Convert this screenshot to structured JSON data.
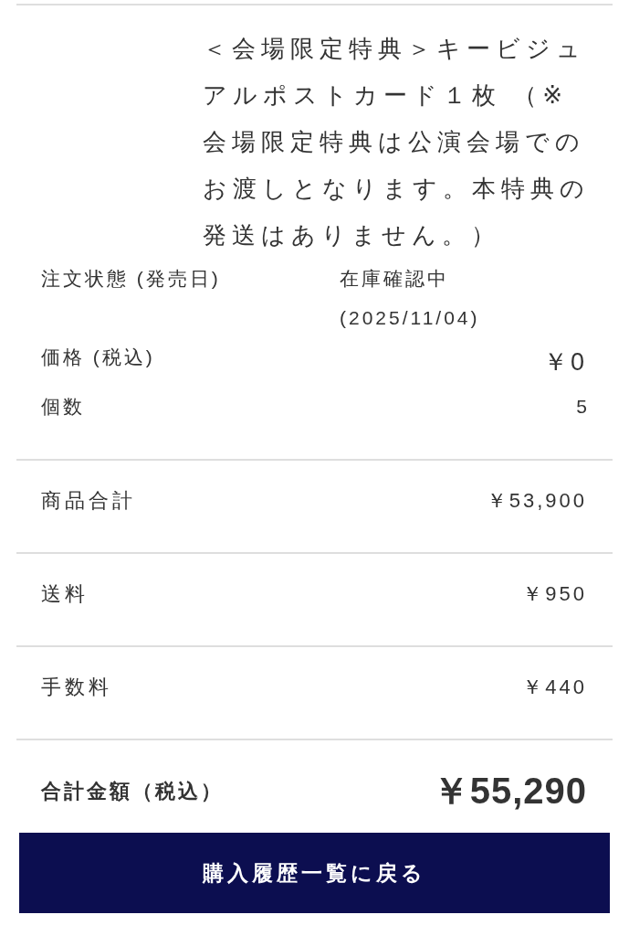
{
  "item": {
    "description": "＜会場限定特典＞キービジュアルポストカード１枚 （※会場限定特典は公演会場でのお渡しとなります。本特典の発送はありません。）"
  },
  "details": [
    {
      "kind": "status",
      "label": "注文状態 (発売日)",
      "value": "在庫確認中",
      "date": "(2025/11/04)"
    },
    {
      "kind": "price",
      "label": "価格 (税込)",
      "value": "￥0"
    },
    {
      "kind": "quantity",
      "label": "個数",
      "value": "5"
    }
  ],
  "summary": [
    {
      "label": "商品合計",
      "value": "￥53,900"
    },
    {
      "label": "送料",
      "value": "￥950"
    },
    {
      "label": "手数料",
      "value": "￥440"
    }
  ],
  "total": {
    "label": "合計金額（税込）",
    "value": "￥55,290"
  },
  "back_button": {
    "label": "購入履歴一覧に戻る"
  }
}
